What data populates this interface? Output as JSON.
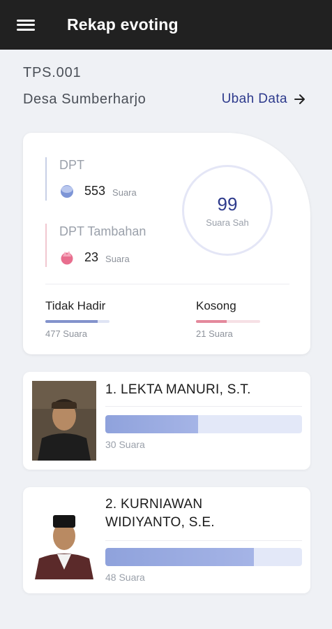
{
  "appbar": {
    "title": "Rekap evoting"
  },
  "location": {
    "tps": "TPS.001",
    "desa": "Desa Sumberharjo",
    "edit_label": "Ubah Data"
  },
  "summary": {
    "dpt": {
      "label": "DPT",
      "value": "553",
      "unit": "Suara"
    },
    "dpt_tambahan": {
      "label": "DPT Tambahan",
      "value": "23",
      "unit": "Suara"
    },
    "suara_sah": {
      "value": "99",
      "label": "Suara Sah"
    },
    "tidak_hadir": {
      "label": "Tidak Hadir",
      "value": "477 Suara",
      "fill": 0.82
    },
    "kosong": {
      "label": "Kosong",
      "value": "21 Suara",
      "fill": 0.48
    }
  },
  "candidates": [
    {
      "name": "1. LEKTA MANURI, S.T.",
      "votes": "30 Suara",
      "fill": 0.47
    },
    {
      "name": "2. KURNIAWAN WIDIYANTO, S.E.",
      "votes": "48 Suara",
      "fill": 0.755
    }
  ],
  "colors": {
    "appbar": "#212121",
    "accent": "#2d3a8c",
    "bar": "#8fa2dc",
    "pink": "#e4899c"
  }
}
